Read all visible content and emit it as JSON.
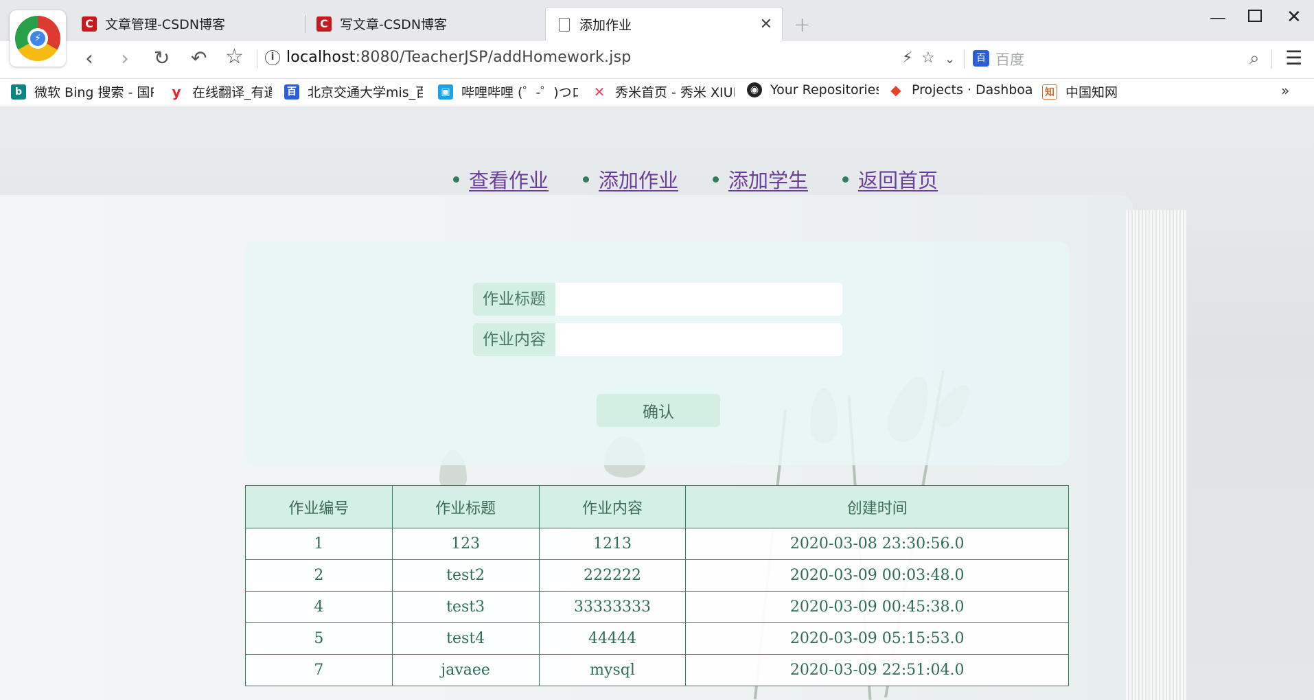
{
  "browser": {
    "tabs": [
      {
        "title": "文章管理-CSDN博客",
        "icon": "csdn-icon"
      },
      {
        "title": "写文章-CSDN博客",
        "icon": "csdn-icon"
      },
      {
        "title": "添加作业",
        "icon": "document-icon",
        "active": true
      }
    ],
    "url_host": "localhost",
    "url_path": ":8080/TeacherJSP/addHomework.jsp",
    "search_placeholder": "百度",
    "bookmarks": [
      {
        "label": "微软 Bing 搜索 - 国P",
        "icon": "bing-icon",
        "color": "#0c8484"
      },
      {
        "label": "在线翻译_有道",
        "icon": "youdao-icon",
        "color": "#e5262c"
      },
      {
        "label": "北京交通大学mis_百",
        "icon": "baidu-icon",
        "color": "#2c5fd6"
      },
      {
        "label": "哔哩哔哩 (゜-゜)つロ",
        "icon": "bilibili-icon",
        "color": "#1ca3e6"
      },
      {
        "label": "秀米首页 - 秀米 XIUM",
        "icon": "xiumi-icon",
        "color": "#e9415a"
      },
      {
        "label": "Your Repositories",
        "icon": "github-icon",
        "color": "#222222"
      },
      {
        "label": "Projects · Dashboard",
        "icon": "gitlab-icon",
        "color": "#e24329"
      },
      {
        "label": "中国知网",
        "icon": "cnki-icon",
        "color": "#c9702c"
      }
    ]
  },
  "nav": {
    "links": [
      "查看作业",
      "添加作业",
      "添加学生",
      "返回首页"
    ]
  },
  "form": {
    "title_label": "作业标题",
    "title_value": "",
    "content_label": "作业内容",
    "content_value": "",
    "confirm_label": "确认"
  },
  "table": {
    "headers": [
      "作业编号",
      "作业标题",
      "作业内容",
      "创建时间"
    ],
    "rows": [
      [
        "1",
        "123",
        "1213",
        "2020-03-08 23:30:56.0"
      ],
      [
        "2",
        "test2",
        "222222",
        "2020-03-09 00:03:48.0"
      ],
      [
        "4",
        "test3",
        "33333333",
        "2020-03-09 00:45:38.0"
      ],
      [
        "5",
        "test4",
        "44444",
        "2020-03-09 05:15:53.0"
      ],
      [
        "7",
        "javaee",
        "mysql",
        "2020-03-09 22:51:04.0"
      ]
    ]
  },
  "colors": {
    "accent_green": "#2f7d5b",
    "link_purple": "#6a3d98",
    "label_bg": "#d3eee3"
  }
}
